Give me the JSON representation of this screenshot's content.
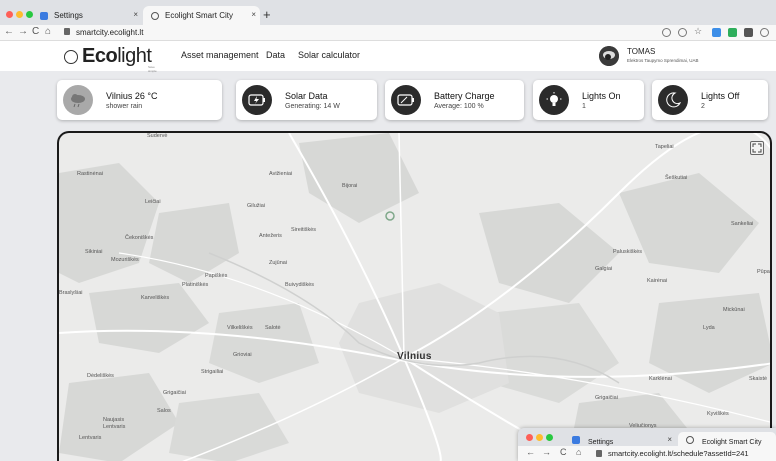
{
  "browser": {
    "tabs": [
      {
        "title": "Settings",
        "icon": "gear-icon"
      },
      {
        "title": "Ecolight Smart City",
        "icon": "ecolight-icon"
      }
    ],
    "new_tab": "+",
    "url": "smartcity.ecolight.lt",
    "back": "←",
    "forward": "→",
    "reload": "C",
    "home": "⌂",
    "close_glyph": "×"
  },
  "app": {
    "logo_text_bold": "Eco",
    "logo_text_light": "light",
    "logo_tagline": "Save simple",
    "nav": [
      "Asset management",
      "Data",
      "Solar calculator"
    ],
    "user": {
      "name": "TOMAS",
      "company": "Elektros Taupymo Sprendimai, UAB"
    }
  },
  "cards": [
    {
      "title": "Vilnius 26 °C",
      "subtitle": "shower rain",
      "icon": "cloud-rain-icon",
      "icon_bg": "#a9a9a9"
    },
    {
      "title": "Solar Data",
      "subtitle": "Generating: 14 W",
      "icon": "battery-charging-icon",
      "icon_bg": "#2b2b2b"
    },
    {
      "title": "Battery Charge",
      "subtitle": "Average: 100 %",
      "icon": "battery-icon",
      "icon_bg": "#2b2b2b"
    },
    {
      "title": "Lights On",
      "subtitle": "1",
      "icon": "lightbulb-icon",
      "icon_bg": "#2b2b2b"
    },
    {
      "title": "Lights Off",
      "subtitle": "2",
      "icon": "moon-icon",
      "icon_bg": "#2b2b2b"
    }
  ],
  "map": {
    "city": "Vilnius",
    "labels": [
      "Sudervė",
      "Rastinėnai",
      "Avižieniai",
      "Bijorai",
      "Leičiai",
      "Gilužiai",
      "Čekoniškės",
      "Antežeris",
      "Sireitiškės",
      "Sikiniai",
      "Mozuriškės",
      "Zujūnai",
      "Papiškės",
      "Platiniškės",
      "Buivydiškės",
      "Karveliškės",
      "Vilkeliškės",
      "Salotė",
      "Grioviai",
      "Dėdeliškės",
      "Grigaičiai",
      "Salos",
      "Naujasis Lentvaris",
      "Lentvaris",
      "Strigailiai",
      "Tapeliai",
      "Šeškutiai",
      "Sankeliai",
      "Paluskiškės",
      "Galgiai",
      "Kairėnai",
      "Mickūnai",
      "Lyda",
      "Karklėnai",
      "Grigaičiai",
      "Kyviškės",
      "Veliučionys",
      "Skaistė",
      "Pūpa",
      "Braslyšiai"
    ]
  },
  "overlay_browser": {
    "tabs": [
      {
        "title": "Settings",
        "icon": "gear-icon"
      },
      {
        "title": "Ecolight Smart City",
        "icon": "ecolight-icon"
      }
    ],
    "url": "smartcity.ecolight.lt/schedule?assetId=241"
  },
  "colors": {
    "accent": "#2b2b2b",
    "map_bg": "#ebebea",
    "map_forest": "#d7d8d6",
    "map_road": "#ffffff"
  }
}
